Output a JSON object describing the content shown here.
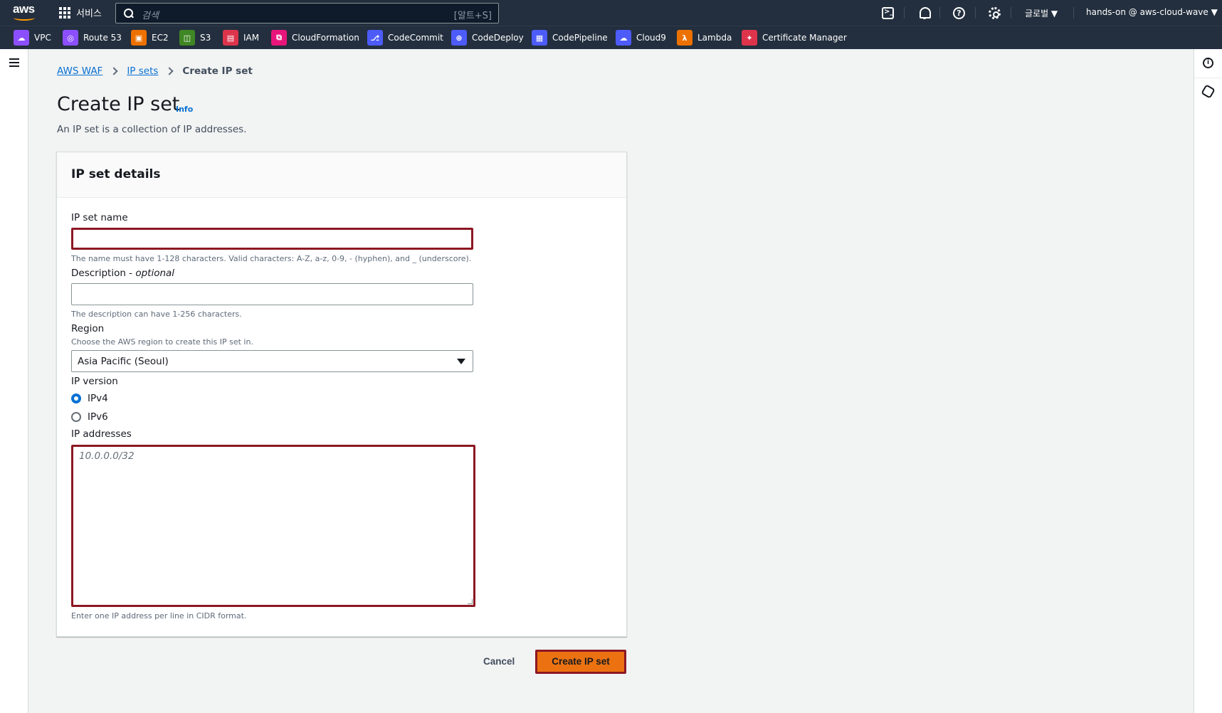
{
  "topnav": {
    "services_label": "서비스",
    "search_placeholder": "검색",
    "search_shortcut": "[알트+S]",
    "region_label": "글로벌 ▼",
    "account_label": "hands-on @ aws-cloud-wave ▼"
  },
  "favorites": [
    {
      "label": "VPC",
      "icon": "vpc-icon",
      "color": "#8c4fff"
    },
    {
      "label": "Route 53",
      "icon": "route53-icon",
      "color": "#8c4fff"
    },
    {
      "label": "EC2",
      "icon": "ec2-icon",
      "color": "#ed7100"
    },
    {
      "label": "S3",
      "icon": "s3-icon",
      "color": "#3f8624"
    },
    {
      "label": "IAM",
      "icon": "iam-icon",
      "color": "#dd344c"
    },
    {
      "label": "CloudFormation",
      "icon": "cloudformation-icon",
      "color": "#e7157b"
    },
    {
      "label": "CodeCommit",
      "icon": "codecommit-icon",
      "color": "#4d5bf9"
    },
    {
      "label": "CodeDeploy",
      "icon": "codedeploy-icon",
      "color": "#4d5bf9"
    },
    {
      "label": "CodePipeline",
      "icon": "codepipeline-icon",
      "color": "#4d5bf9"
    },
    {
      "label": "Cloud9",
      "icon": "cloud9-icon",
      "color": "#4d5bf9"
    },
    {
      "label": "Lambda",
      "icon": "lambda-icon",
      "color": "#ed7100"
    },
    {
      "label": "Certificate Manager",
      "icon": "certificate-manager-icon",
      "color": "#dd344c"
    }
  ],
  "breadcrumb": {
    "items": [
      "AWS WAF",
      "IP sets"
    ],
    "current": "Create IP set"
  },
  "page": {
    "title": "Create IP set",
    "info_link": "Info",
    "description": "An IP set is a collection of IP addresses."
  },
  "panel": {
    "title": "IP set details",
    "name_label": "IP set name",
    "name_value": "",
    "name_hint": "The name must have 1-128 characters. Valid characters: A-Z, a-z, 0-9, - (hyphen), and _ (underscore).",
    "description_label": "Description - ",
    "description_optional": "optional",
    "description_value": "",
    "description_hint": "The description can have 1-256 characters.",
    "region_label": "Region",
    "region_hint": "Choose the AWS region to create this IP set in.",
    "region_value": "Asia Pacific (Seoul)",
    "ip_version_label": "IP version",
    "ip_versions": [
      {
        "label": "IPv4",
        "checked": true
      },
      {
        "label": "IPv6",
        "checked": false
      }
    ],
    "ip_addresses_label": "IP addresses",
    "ip_addresses_placeholder": "10.0.0.0/32",
    "ip_addresses_hint": "Enter one IP address per line in CIDR format."
  },
  "actions": {
    "cancel": "Cancel",
    "create": "Create IP set"
  },
  "colors": {
    "nav_bg": "#232f3e",
    "link": "#0972d3",
    "primary_button": "#ec7211",
    "highlight_border": "#8c1823"
  }
}
